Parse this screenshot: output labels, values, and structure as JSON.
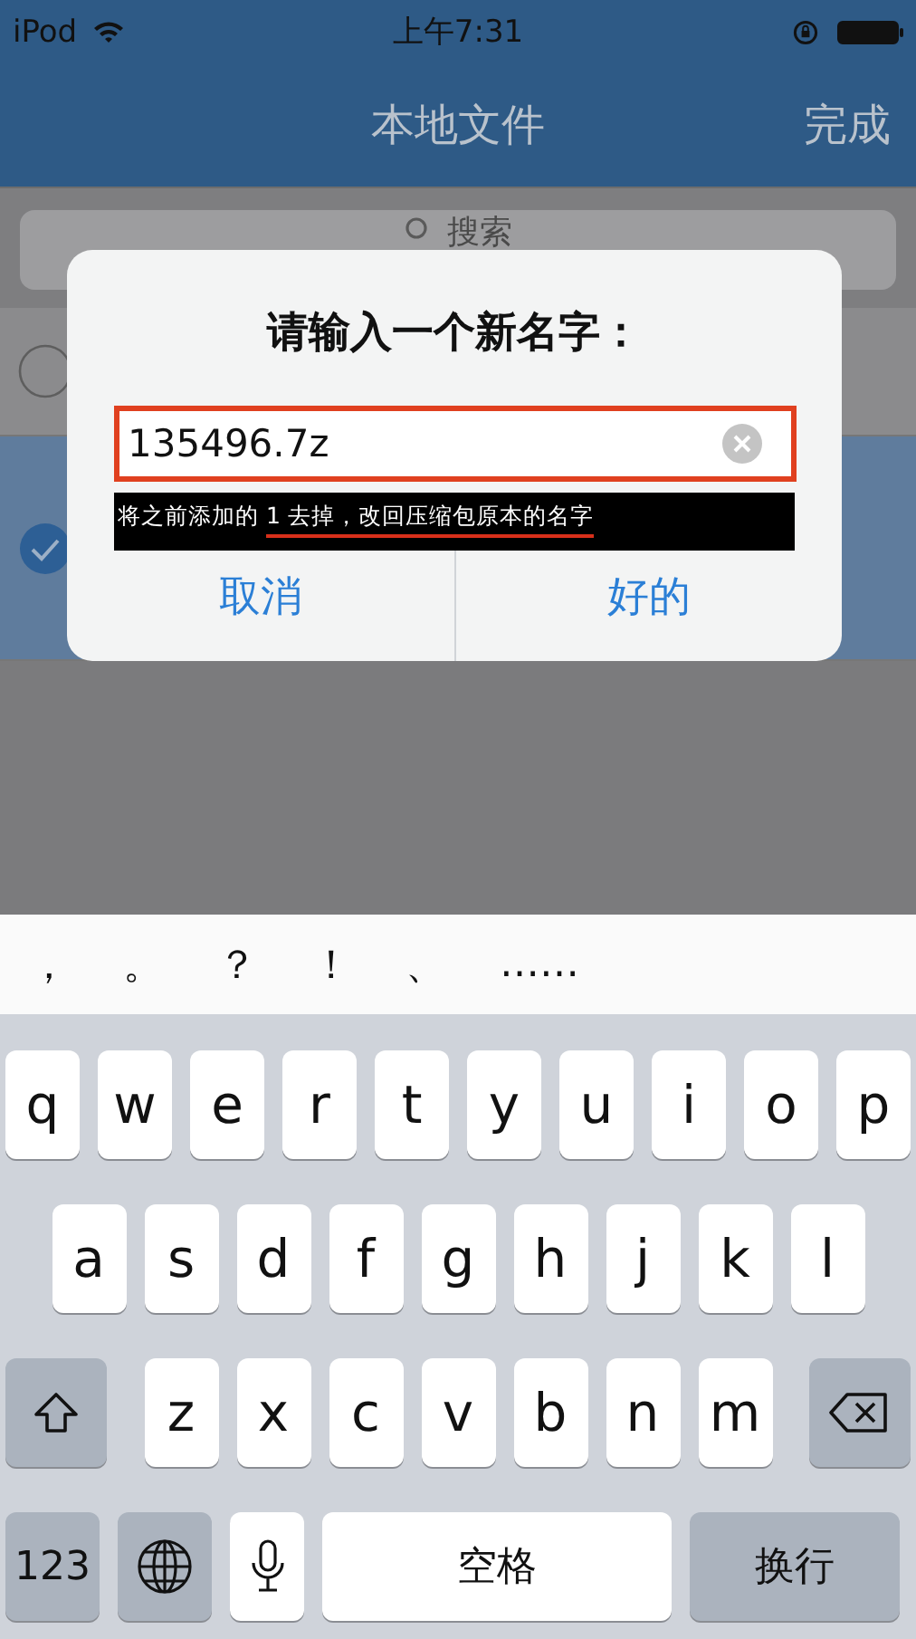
{
  "status_bar": {
    "carrier": "iPod",
    "time": "上午7:31"
  },
  "nav_bar": {
    "title": "本地文件",
    "action": "完成"
  },
  "search": {
    "placeholder": "搜索"
  },
  "files": [
    {
      "selected": false
    },
    {
      "selected": true
    }
  ],
  "dialog": {
    "title": "请输入一个新名字：",
    "input_value": "135496.7z",
    "buttons": [
      {
        "label": "取消"
      },
      {
        "label": "好的"
      }
    ]
  },
  "caption": {
    "lead": "将之前添加的 ",
    "underlined": "1 去掉，改回压缩包原本的名字"
  },
  "keyboard": {
    "suggestions": [
      "，",
      "。",
      "？",
      "！",
      "、",
      "……"
    ],
    "rows": [
      [
        "q",
        "w",
        "e",
        "r",
        "t",
        "y",
        "u",
        "i",
        "o",
        "p"
      ],
      [
        "a",
        "s",
        "d",
        "f",
        "g",
        "h",
        "j",
        "k",
        "l"
      ],
      [
        "z",
        "x",
        "c",
        "v",
        "b",
        "n",
        "m"
      ]
    ],
    "number_key": "123",
    "space_key": "空格",
    "return_key": "换行"
  }
}
